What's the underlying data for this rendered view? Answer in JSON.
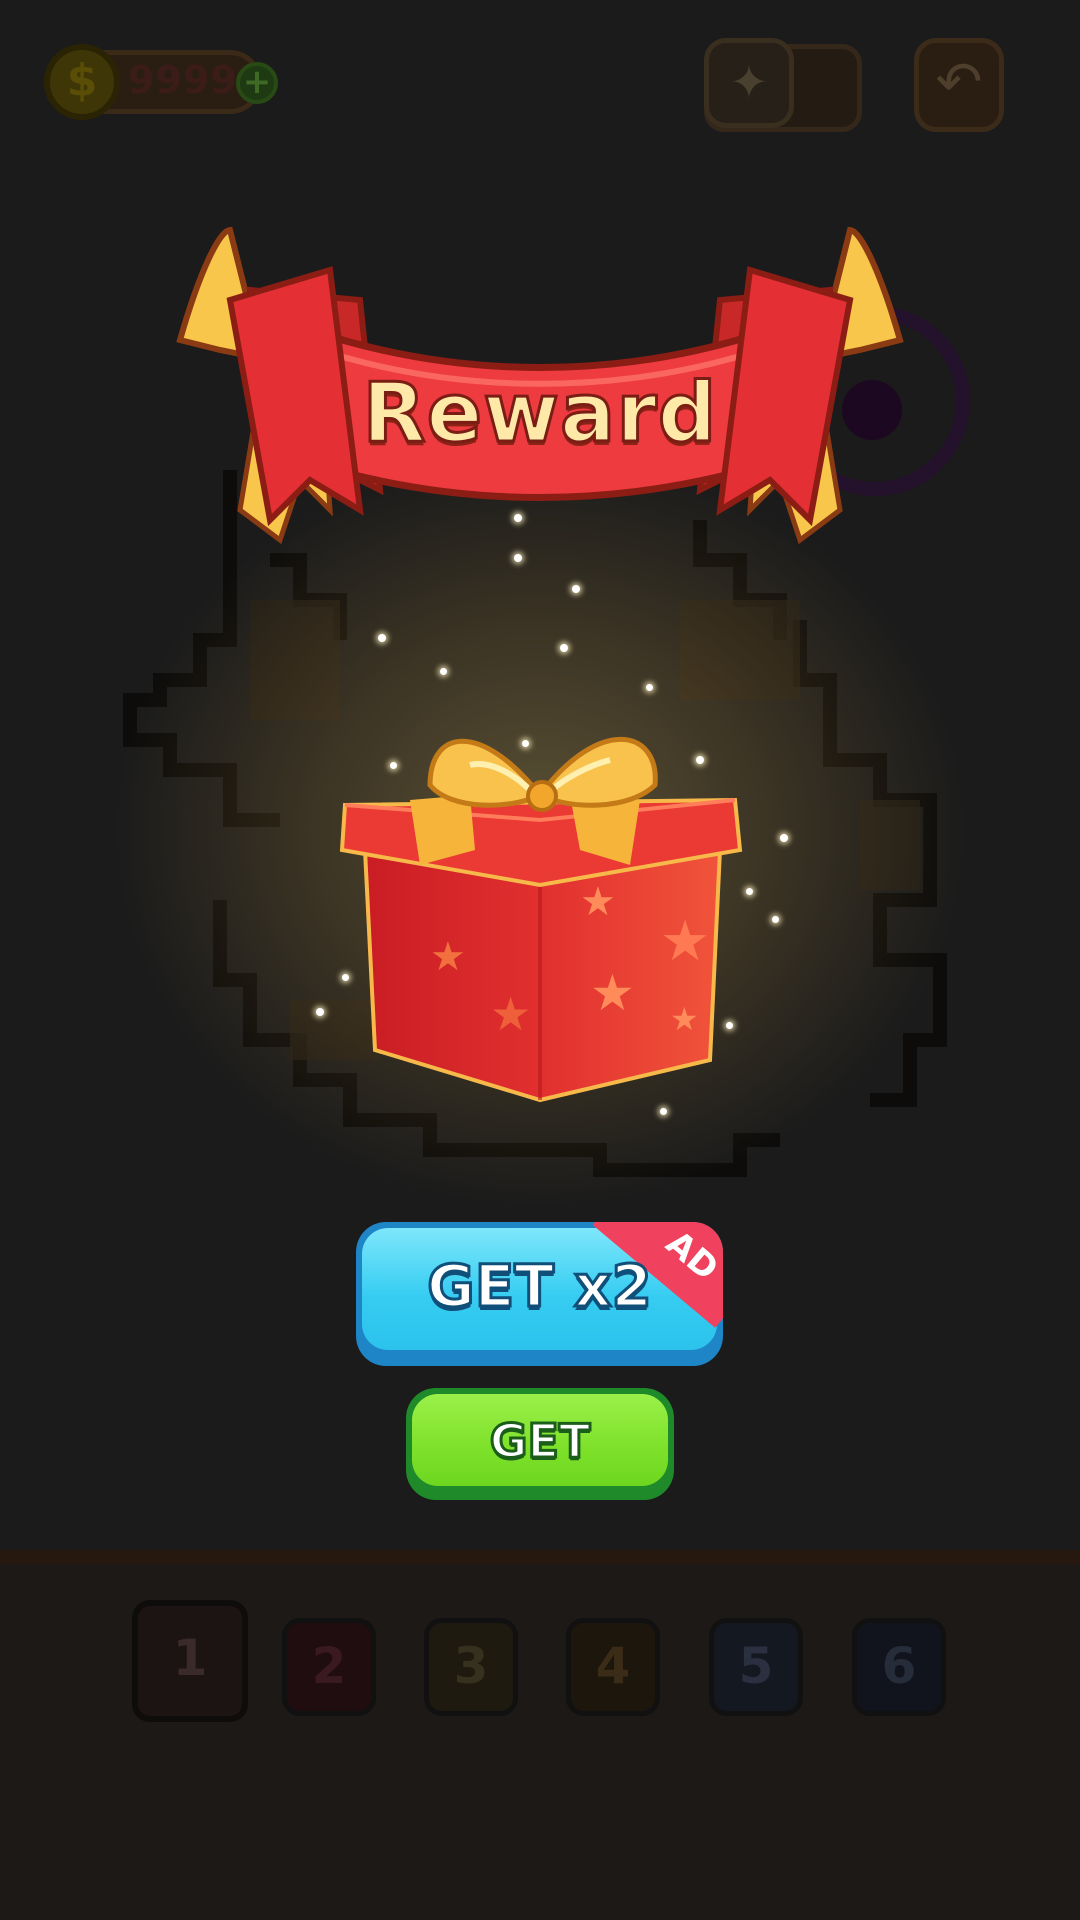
{
  "hud": {
    "coin_count": "9999",
    "coin_icon": "dollar-coin-icon",
    "add_coins_icon": "plus-icon",
    "hint_icon": "sparkle-icon",
    "undo_icon": "undo-arrow-icon"
  },
  "reward": {
    "title": "Reward",
    "ribbon_color": "#e93a3a",
    "gift_icon": "gift-box-icon"
  },
  "buttons": {
    "double_label": "GET x2",
    "ad_badge": "AD",
    "get_label": "GET"
  },
  "palette": {
    "tabs": [
      "1",
      "2",
      "3",
      "4",
      "5",
      "6"
    ],
    "selected": "1"
  },
  "colors": {
    "double_button": "#37cdf2",
    "get_button": "#7de12a",
    "ad_badge": "#f0425e"
  }
}
